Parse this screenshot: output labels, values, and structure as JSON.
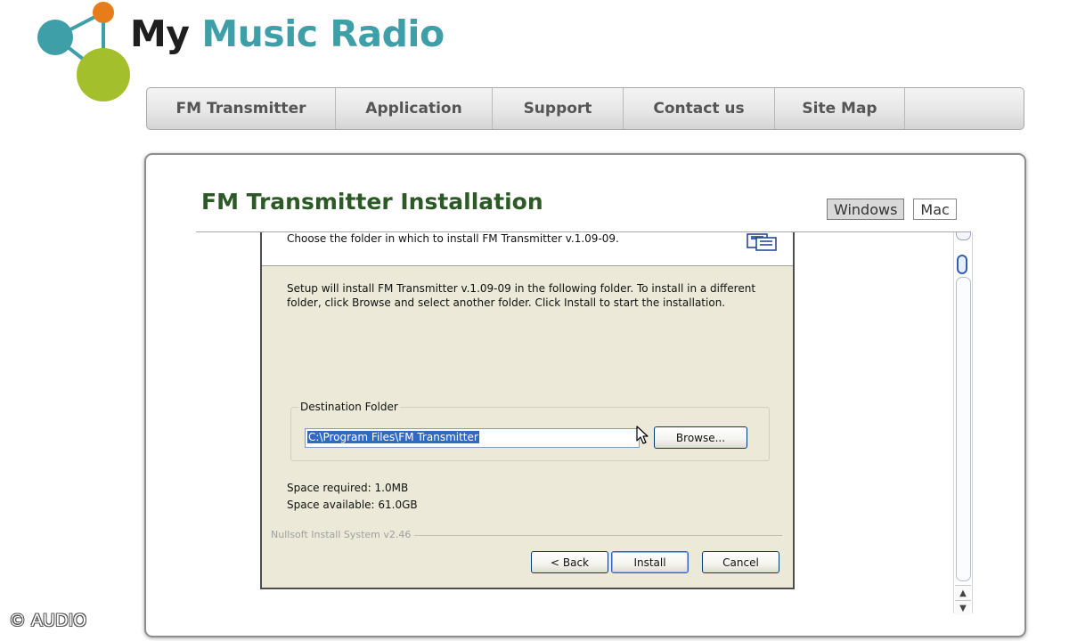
{
  "logo": {
    "word_my": "My",
    "word_rest": "Music Radio",
    "colors": {
      "teal": "#3e9fa8",
      "orange": "#e67c1a",
      "green": "#a3bf2c",
      "dark": "#1e1e1e"
    },
    "icon": "network-nodes-logo-icon"
  },
  "nav": {
    "items": [
      {
        "label": "FM Transmitter"
      },
      {
        "label": "Application"
      },
      {
        "label": "Support"
      },
      {
        "label": "Contact us"
      },
      {
        "label": "Site Map"
      }
    ]
  },
  "page": {
    "title": "FM Transmitter Installation",
    "title_color": "#2c5a26",
    "os_tabs": [
      {
        "label": "Windows",
        "active": true
      },
      {
        "label": "Mac",
        "active": false
      }
    ]
  },
  "installer": {
    "header_text": "Choose the folder in which to install FM Transmitter v.1.09-09.",
    "header_icon": "install-disk-icon",
    "description": "Setup will install FM Transmitter v.1.09-09 in the following folder. To install in a different folder, click Browse and select another folder. Click Install to start the installation.",
    "destination_label": "Destination Folder",
    "destination_value": "C:\\Program Files\\FM Transmitter",
    "browse_label": "Browse...",
    "space_required": "Space required: 1.0MB",
    "space_available": "Space available: 61.0GB",
    "branding": "Nullsoft Install System v2.46",
    "back_label": "< Back",
    "install_label": "Install",
    "cancel_label": "Cancel"
  },
  "scrollbar": {
    "up_glyph": "▲",
    "down_glyph": "▼"
  },
  "watermark": "© AUDIO"
}
